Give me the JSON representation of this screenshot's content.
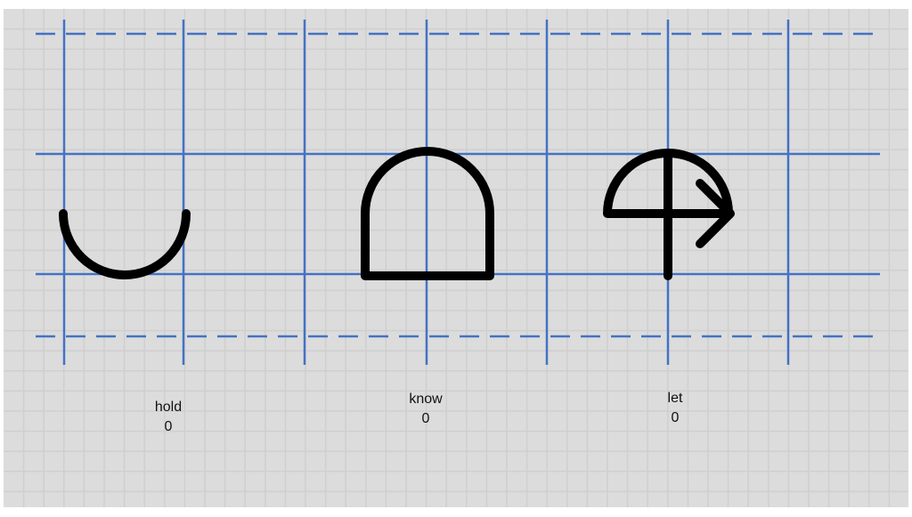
{
  "colors": {
    "background": "#dcdcdc",
    "minor_grid": "#cfcfcf",
    "guide_line": "#4472c4",
    "glyph_stroke": "#000000",
    "label_text": "#111111"
  },
  "glyphs": [
    {
      "word": "hold",
      "count": "0",
      "shape": "cup-arc"
    },
    {
      "word": "know",
      "count": "0",
      "shape": "arch-box"
    },
    {
      "word": "let",
      "count": "0",
      "shape": "umbrella-arrow"
    }
  ]
}
